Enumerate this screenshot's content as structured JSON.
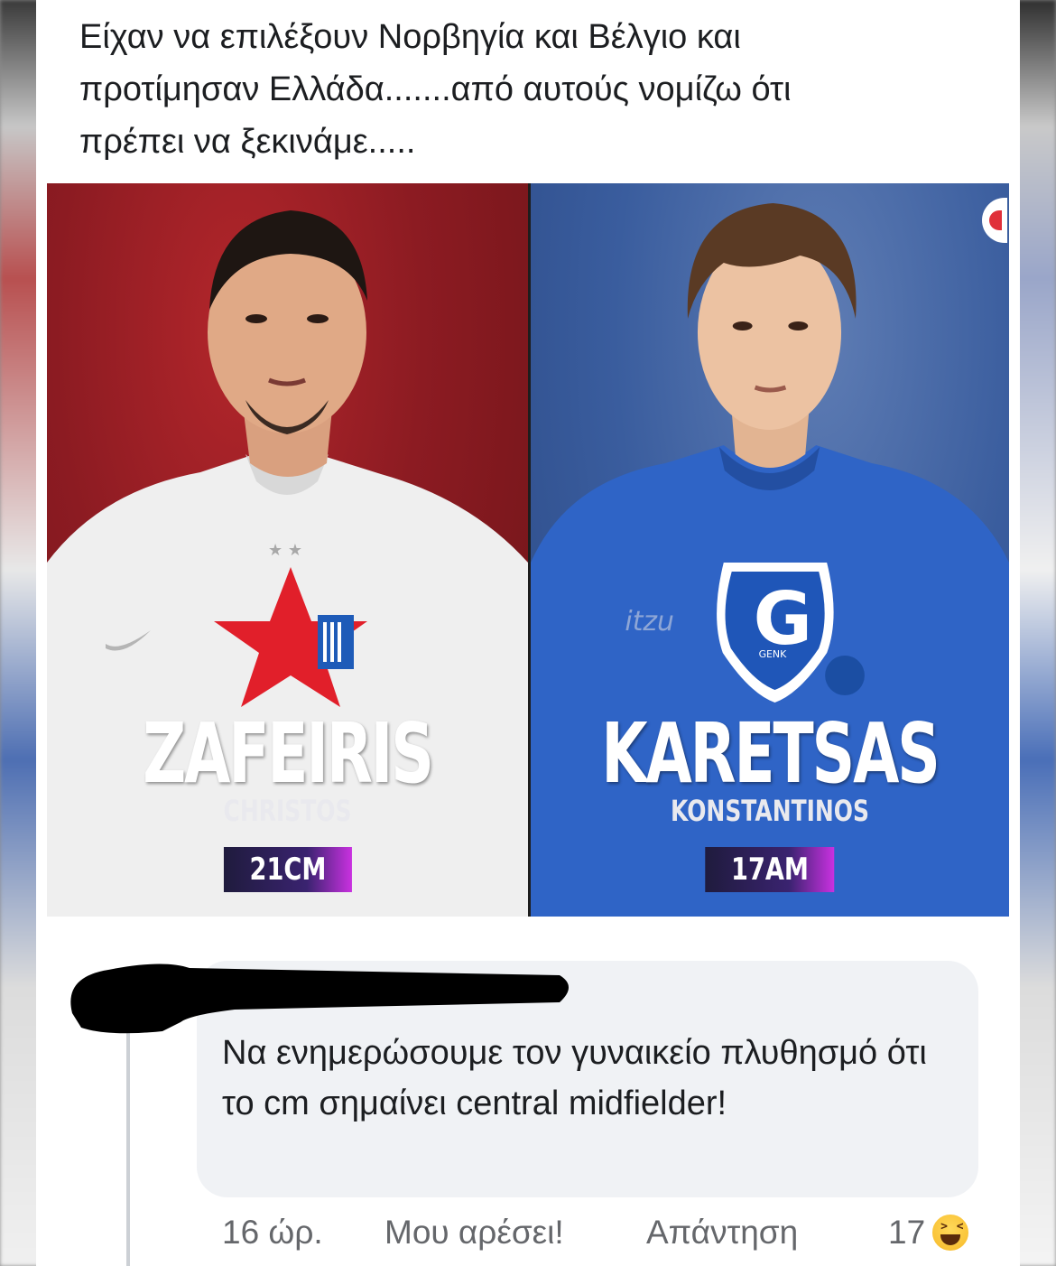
{
  "post": {
    "text": "Είχαν να επιλέξουν Νορβηγία και Βέλγιο και\nπροτίμησαν Ελλάδα.......από αυτούς νομίζω ότι\nπρέπει να ξεκινάμε....."
  },
  "image": {
    "left_player": {
      "last_name": "ZAFEIRIS",
      "first_name": "CHRISTOS",
      "badge": "21CM",
      "shirt_color": "#f2f2f2",
      "background_color": "#8c1b22"
    },
    "right_player": {
      "last_name": "KARETSAS",
      "first_name": "KONSTANTINOS",
      "badge": "17AM",
      "shirt_color": "#2e63c4",
      "background_color": "#3a5d9e",
      "sponsor": "itzu",
      "crest_letter": "G",
      "crest_text": "GENK"
    }
  },
  "comment": {
    "text": "Να ενημερώσουμε τον γυναικείο πλυθησμό ότι το cm σημαίνει central midfielder!",
    "time": "16 ώρ.",
    "like_label": "Μου αρέσει!",
    "reply_label": "Απάντηση",
    "reaction_count": "17",
    "reaction_icon": "haha-emoji-icon"
  }
}
